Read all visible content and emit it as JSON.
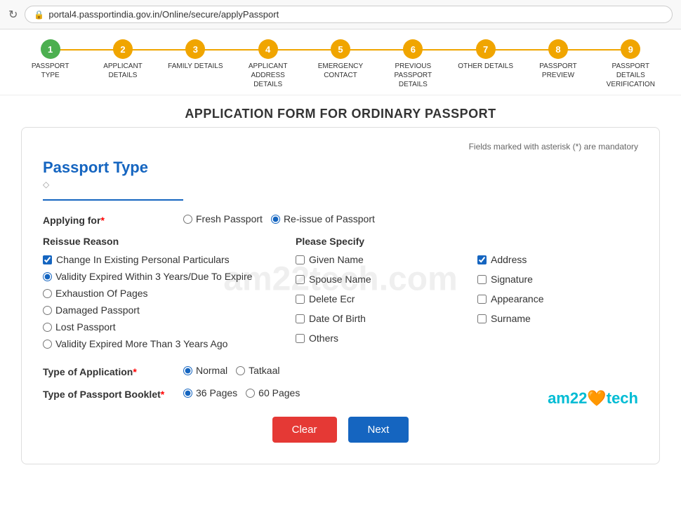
{
  "browser": {
    "url": "portal4.passportindia.gov.in/Online/secure/applyPassport",
    "refresh_icon": "↻",
    "lock_icon": "🔒"
  },
  "steps": [
    {
      "number": "1",
      "label": "PASSPORT TYPE",
      "active": true
    },
    {
      "number": "2",
      "label": "APPLICANT DETAILS",
      "active": false
    },
    {
      "number": "3",
      "label": "FAMILY DETAILS",
      "active": false
    },
    {
      "number": "4",
      "label": "APPLICANT ADDRESS DETAILS",
      "active": false
    },
    {
      "number": "5",
      "label": "EMERGENCY CONTACT",
      "active": false
    },
    {
      "number": "6",
      "label": "PREVIOUS PASSPORT DETAILS",
      "active": false
    },
    {
      "number": "7",
      "label": "OTHER DETAILS",
      "active": false
    },
    {
      "number": "8",
      "label": "PASSPORT PREVIEW",
      "active": false
    },
    {
      "number": "9",
      "label": "PASSPORT DETAILS VERIFICATION",
      "active": false
    }
  ],
  "form": {
    "title": "APPLICATION FORM FOR ORDINARY PASSPORT",
    "mandatory_note": "Fields marked with asterisk (*) are mandatory",
    "section_title": "Passport Type",
    "section_icon": "◇",
    "applying_for_label": "Applying for",
    "applying_for_required": "*",
    "fresh_passport_label": "Fresh Passport",
    "reissue_passport_label": "Re-issue of Passport",
    "reissue_reason_title": "Reissue Reason",
    "please_specify_title": "Please Specify",
    "reissue_reasons": [
      {
        "label": "Change In Existing Personal Particulars",
        "checked": true,
        "type": "checkbox"
      },
      {
        "label": "Validity Expired Within 3 Years/Due To Expire",
        "checked": true,
        "type": "radio"
      },
      {
        "label": "Exhaustion Of Pages",
        "checked": false,
        "type": "radio"
      },
      {
        "label": "Damaged Passport",
        "checked": false,
        "type": "radio"
      },
      {
        "label": "Lost Passport",
        "checked": false,
        "type": "radio"
      },
      {
        "label": "Validity Expired More Than 3 Years Ago",
        "checked": false,
        "type": "radio"
      }
    ],
    "specify_options": [
      {
        "label": "Given Name",
        "checked": false,
        "col": 1
      },
      {
        "label": "Address",
        "checked": true,
        "col": 2
      },
      {
        "label": "Spouse Name",
        "checked": false,
        "col": 1
      },
      {
        "label": "Signature",
        "checked": false,
        "col": 2
      },
      {
        "label": "Delete Ecr",
        "checked": false,
        "col": 1
      },
      {
        "label": "Appearance",
        "checked": false,
        "col": 2
      },
      {
        "label": "Date Of Birth",
        "checked": false,
        "col": 1
      },
      {
        "label": "Surname",
        "checked": false,
        "col": 2
      },
      {
        "label": "Others",
        "checked": false,
        "col": 1
      }
    ],
    "type_of_application_label": "Type of Application",
    "type_of_application_required": "*",
    "application_types": [
      {
        "label": "Normal",
        "checked": true
      },
      {
        "label": "Tatkaal",
        "checked": false
      }
    ],
    "type_of_booklet_label": "Type of Passport Booklet",
    "type_of_booklet_required": "*",
    "booklet_types": [
      {
        "label": "36 Pages",
        "checked": true
      },
      {
        "label": "60 Pages",
        "checked": false
      }
    ],
    "clear_button": "Clear",
    "next_button": "Next"
  },
  "branding": {
    "text_before": "am22",
    "heart": "🧡",
    "text_after": "tech"
  }
}
